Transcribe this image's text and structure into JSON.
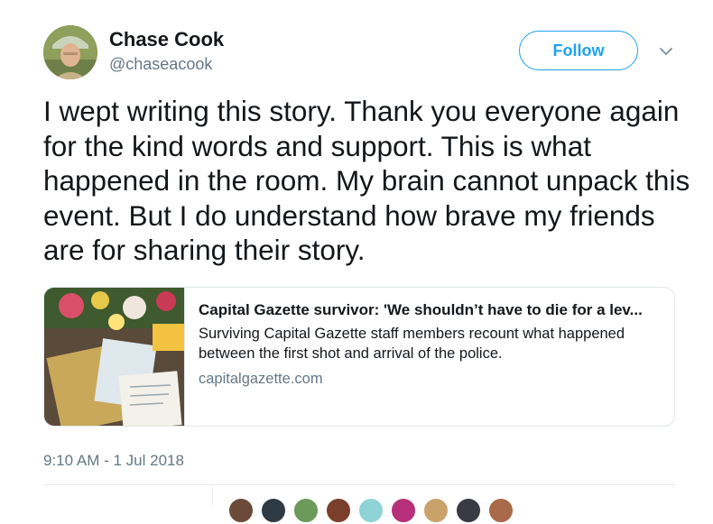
{
  "author": {
    "display_name": "Chase Cook",
    "handle": "@chaseacook",
    "avatar_icon": "profile-photo"
  },
  "follow_button": {
    "label": "Follow"
  },
  "menu_icon": "chevron-down-icon",
  "tweet": {
    "text": "I wept writing this story. Thank you everyone again for the kind words and support. This is what happened in the room. My brain cannot unpack this event. But I do understand how brave my friends are for sharing their story."
  },
  "link_card": {
    "title": "Capital Gazette survivor: 'We shouldn’t have to die for a lev...",
    "description": "Surviving Capital Gazette staff members recount what happened between the first shot and arrival of the police.",
    "domain": "capitalgazette.com"
  },
  "timestamp": "9:10 AM - 1 Jul 2018",
  "colors": {
    "accent": "#1da1f2",
    "text": "#14171a",
    "muted": "#657786",
    "border": "#e1e8ed"
  }
}
